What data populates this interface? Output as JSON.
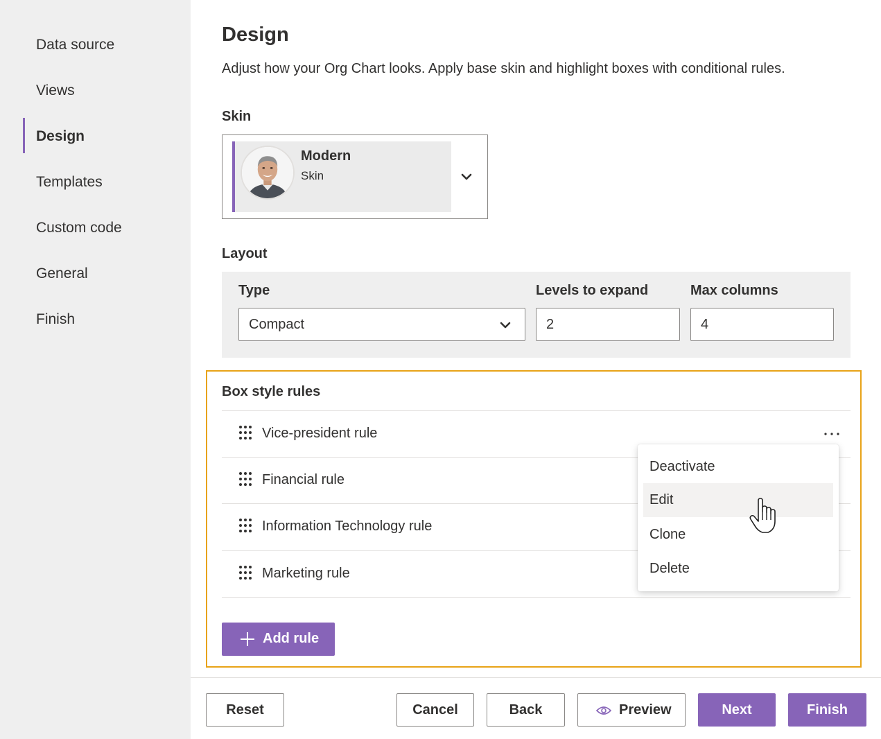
{
  "sidebar": {
    "items": [
      {
        "label": "Data source"
      },
      {
        "label": "Views"
      },
      {
        "label": "Design"
      },
      {
        "label": "Templates"
      },
      {
        "label": "Custom code"
      },
      {
        "label": "General"
      },
      {
        "label": "Finish"
      }
    ],
    "active": "Design",
    "accent_color": "#8764b8"
  },
  "main": {
    "title": "Design",
    "description": "Adjust how your Org Chart looks. Apply base skin and highlight boxes with conditional rules.",
    "skin": {
      "label": "Skin",
      "selected_name": "Modern",
      "selected_sub": "Skin",
      "icon": "chevron-down-icon"
    },
    "layout": {
      "label": "Layout",
      "type_label": "Type",
      "type_value": "Compact",
      "levels_label": "Levels to expand",
      "levels_value": "2",
      "max_columns_label": "Max columns",
      "max_columns_value": "4"
    },
    "rules": {
      "title": "Box style rules",
      "items": [
        {
          "name": "Vice-president rule"
        },
        {
          "name": "Financial rule"
        },
        {
          "name": "Information Technology rule"
        },
        {
          "name": "Marketing rule"
        }
      ],
      "add_label": "Add rule",
      "highlight_color": "#e8a317"
    },
    "context_menu": {
      "items": [
        {
          "label": "Deactivate"
        },
        {
          "label": "Edit"
        },
        {
          "label": "Clone"
        },
        {
          "label": "Delete"
        }
      ],
      "hovered": "Edit"
    }
  },
  "footer": {
    "reset": "Reset",
    "cancel": "Cancel",
    "back": "Back",
    "preview": "Preview",
    "next": "Next",
    "finish": "Finish"
  }
}
